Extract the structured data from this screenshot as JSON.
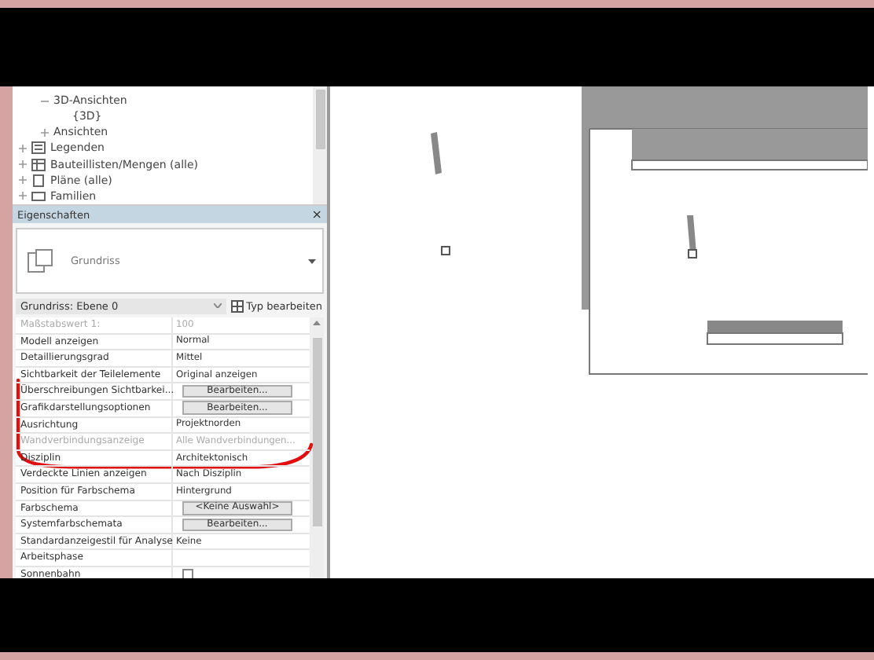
{
  "browser": {
    "items": [
      {
        "label": "3D-Ansichten",
        "expanded": true,
        "children": [
          {
            "label": "{3D}"
          }
        ]
      },
      {
        "label": "Ansichten",
        "expanded": false
      }
    ],
    "groups": [
      {
        "label": "Legenden",
        "kind": "legend",
        "expanded": false
      },
      {
        "label": "Bauteillisten/Mengen (alle)",
        "kind": "schedule",
        "expanded": false
      },
      {
        "label": "Pläne (alle)",
        "kind": "sheet",
        "expanded": false
      },
      {
        "label": "Familien",
        "kind": "family",
        "expanded": false
      }
    ]
  },
  "properties": {
    "title": "Eigenschaften",
    "close": "×",
    "type_name": "Grundriss",
    "instance": "Grundriss: Ebene 0",
    "edit_type": "Typ bearbeiten",
    "rows": [
      {
        "label": "Maßstabswert 1:",
        "value": "100",
        "kind": "text",
        "disabled": true
      },
      {
        "label": "Modell anzeigen",
        "value": "Normal",
        "kind": "text",
        "disabled": false
      },
      {
        "label": "Detaillierungsgrad",
        "value": "Mittel",
        "kind": "text",
        "disabled": false
      },
      {
        "label": "Sichtbarkeit der Teilelemente",
        "value": "Original anzeigen",
        "kind": "text",
        "disabled": false
      },
      {
        "label": "Überschreibungen Sichtbarkei...",
        "value": "Bearbeiten...",
        "kind": "button",
        "disabled": false
      },
      {
        "label": "Grafikdarstellungsoptionen",
        "value": "Bearbeiten...",
        "kind": "button",
        "disabled": false
      },
      {
        "label": "Ausrichtung",
        "value": "Projektnorden",
        "kind": "text",
        "disabled": false
      },
      {
        "label": "Wandverbindungsanzeige",
        "value": "Alle Wandverbindungen...",
        "kind": "text",
        "disabled": true
      },
      {
        "label": "Disziplin",
        "value": "Architektonisch",
        "kind": "text",
        "disabled": false
      },
      {
        "label": "Verdeckte Linien anzeigen",
        "value": "Nach Disziplin",
        "kind": "text",
        "disabled": false
      },
      {
        "label": "Position für Farbschema",
        "value": "Hintergrund",
        "kind": "text",
        "disabled": false
      },
      {
        "label": "Farbschema",
        "value": "<Keine Auswahl>",
        "kind": "button",
        "disabled": false
      },
      {
        "label": "Systemfarbschemata",
        "value": "Bearbeiten...",
        "kind": "button",
        "disabled": false
      },
      {
        "label": "Standardanzeigestil für Analyse",
        "value": "Keine",
        "kind": "text",
        "disabled": false
      },
      {
        "label": "Arbeitsphase",
        "kind": "text",
        "disabled": false
      },
      {
        "label": "Sonnenbahn",
        "kind": "checkbox",
        "checked": false,
        "disabled": false
      }
    ]
  }
}
